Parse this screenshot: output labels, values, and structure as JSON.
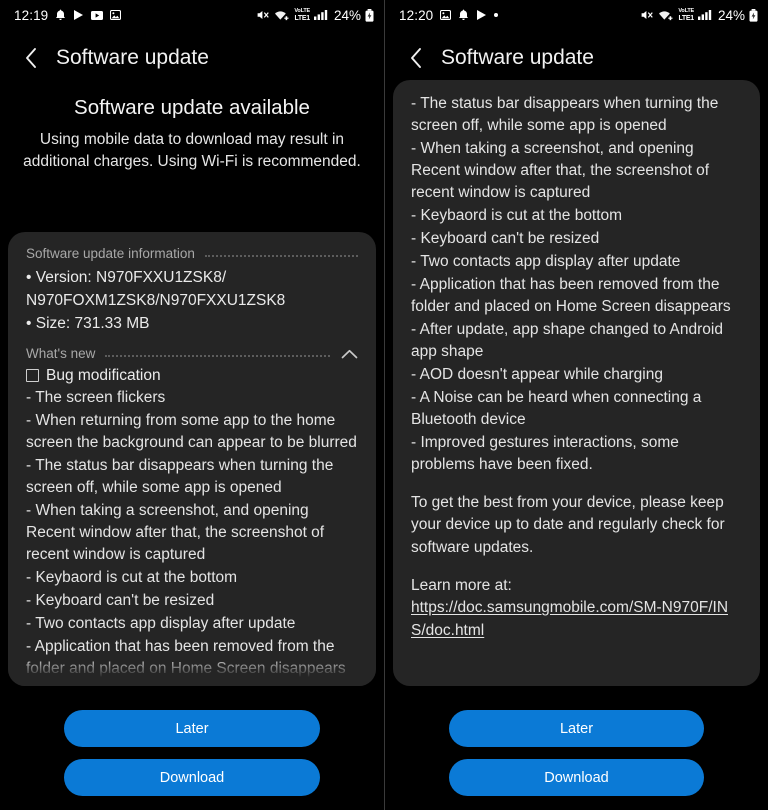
{
  "accent_color": "#0b7ad6",
  "card_color": "#252525",
  "background_color": "#000000",
  "left": {
    "status_bar": {
      "time": "12:19",
      "battery_percent": "24%",
      "left_icons": [
        "bell-icon",
        "play-store-icon",
        "video-icon",
        "image-icon"
      ],
      "right_icons": [
        "mute-icon",
        "wifi-icon",
        "volte-lte1-icon",
        "signal-bars-icon",
        "battery-charging-icon"
      ],
      "network_label_top": "VoLTE",
      "network_label_bottom": "LTE1"
    },
    "appbar": {
      "title": "Software update",
      "back_icon": "chevron-left-icon"
    },
    "hero": {
      "title": "Software update available",
      "subtitle": "Using mobile data to download may result in additional charges. Using Wi-Fi is recommended."
    },
    "info_section": {
      "label": "Software update information",
      "lines": [
        "• Version: N970FXXU1ZSK8/",
        "N970FOXM1ZSK8/N970FXXU1ZSK8",
        "• Size: 731.33 MB"
      ]
    },
    "whats_new": {
      "label": "What's new",
      "collapse_icon": "chevron-up-icon",
      "checkbox_label": "Bug modification",
      "items": [
        " - The screen flickers",
        " - When returning from some app to the home screen the background can appear to be blurred",
        " - The status bar disappears when turning the screen off, while some app is opened",
        " - When taking a screenshot, and opening Recent window after that, the screenshot of recent window is captured",
        " - Keybaord is cut at the bottom",
        " - Keyboard can't be resized",
        " - Two contacts app display after update",
        " - Application that has been removed from the folder and placed on Home Screen disappears"
      ]
    },
    "buttons": {
      "later": "Later",
      "download": "Download"
    }
  },
  "right": {
    "status_bar": {
      "time": "12:20",
      "battery_percent": "24%",
      "left_icons": [
        "image-icon",
        "bell-icon",
        "play-store-icon",
        "dot-icon"
      ],
      "right_icons": [
        "mute-icon",
        "wifi-icon",
        "volte-lte1-icon",
        "signal-bars-icon",
        "battery-charging-icon"
      ],
      "network_label_top": "VoLTE",
      "network_label_bottom": "LTE1"
    },
    "appbar": {
      "title": "Software update",
      "back_icon": "chevron-left-icon"
    },
    "whats_new": {
      "items": [
        " - The status bar disappears when turning the screen off, while some app is opened",
        " - When taking a screenshot, and opening Recent window after that, the screenshot of recent window is captured",
        " - Keybaord is cut at the bottom",
        " - Keyboard can't be resized",
        " - Two contacts app display after update",
        " - Application that has been removed from the folder and placed on Home Screen disappears",
        " - After update, app shape changed to Android app shape",
        " - AOD doesn't appear while charging",
        " - A Noise can be heard when connecting a Bluetooth device",
        " - Improved gestures interactions, some problems have been fixed."
      ],
      "closing_paragraph": "To get the best from your device, please keep your device up to date and regularly check for software updates.",
      "learn_more_label": "Learn more at:",
      "learn_more_url": "https://doc.samsungmobile.com/SM-N970F/INS/doc.html"
    },
    "buttons": {
      "later": "Later",
      "download": "Download"
    }
  }
}
